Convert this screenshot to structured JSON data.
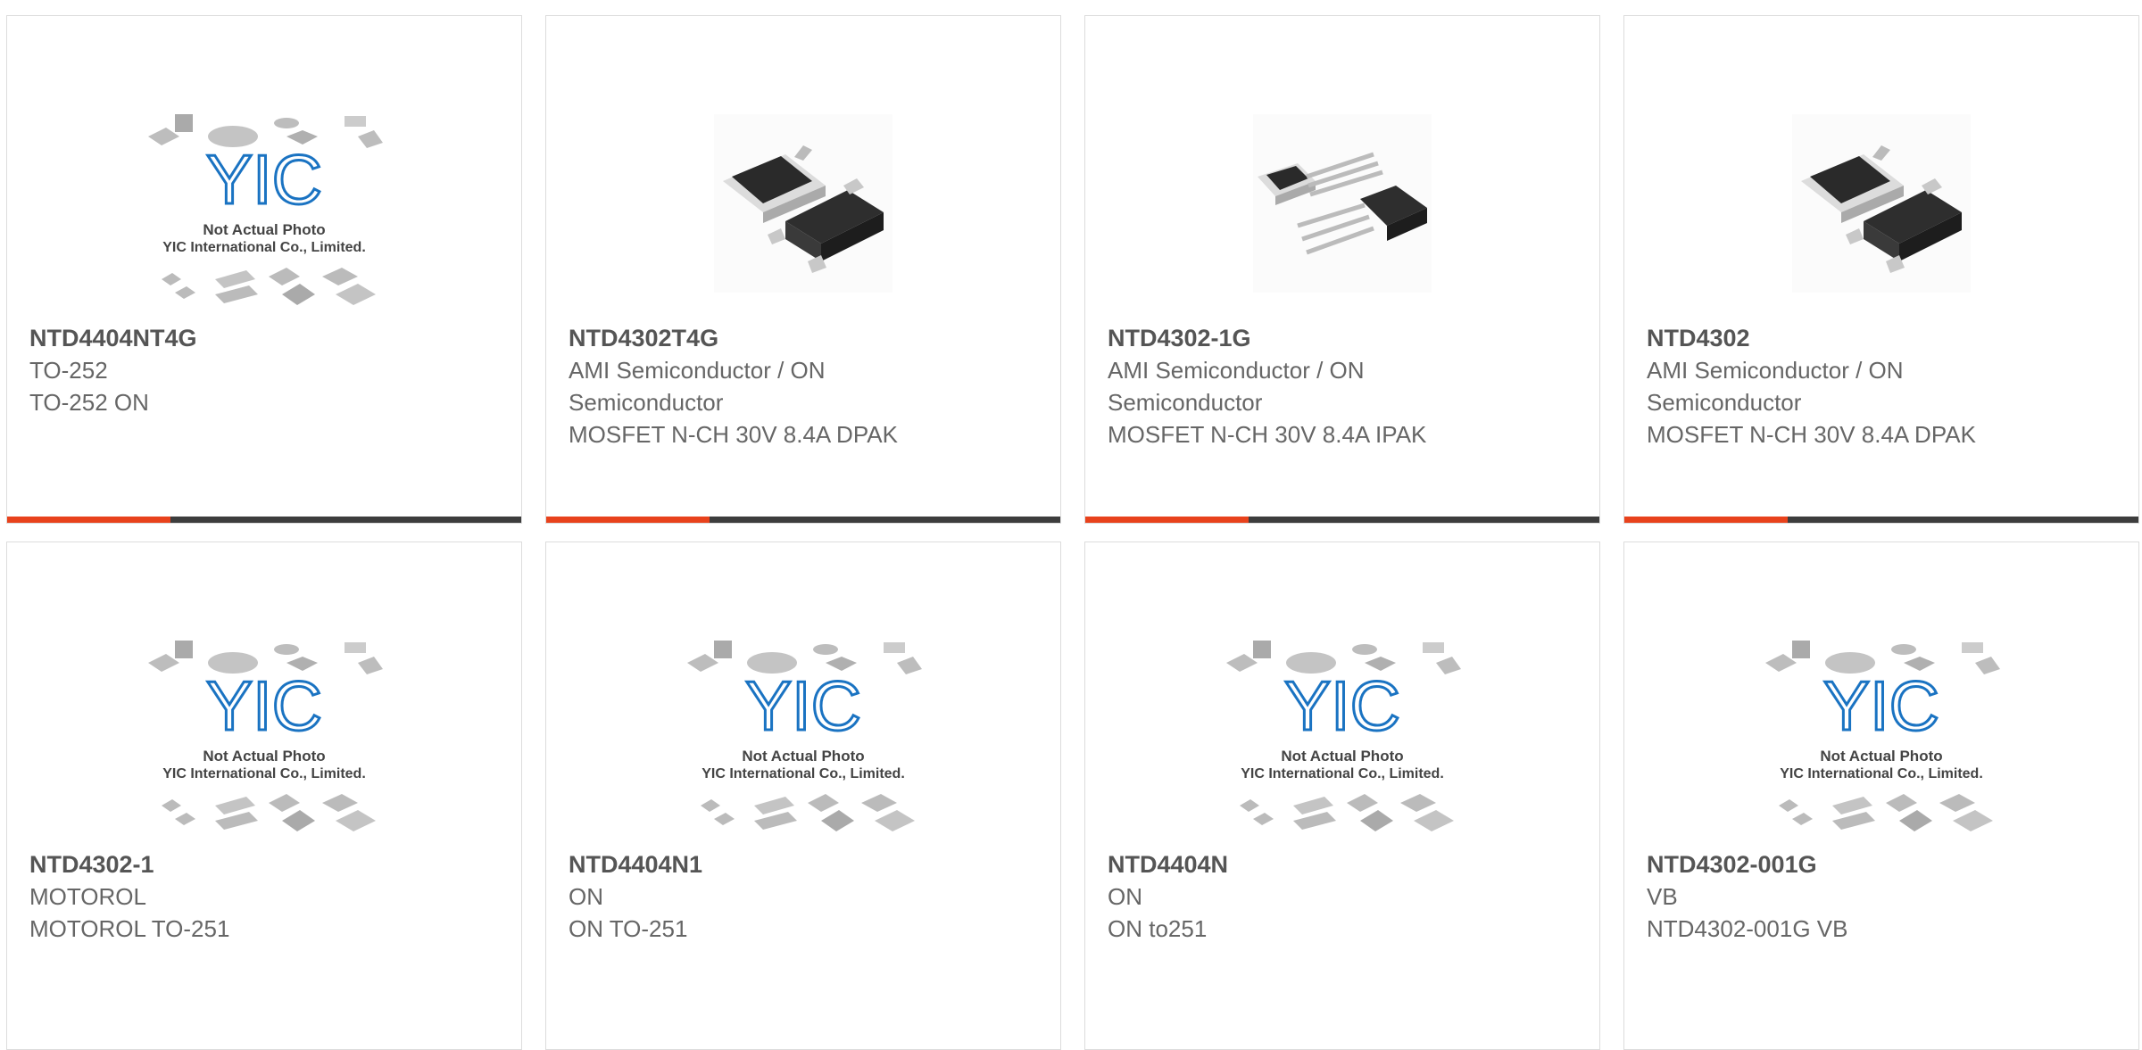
{
  "products": [
    {
      "part": "NTD4404NT4G",
      "lines": [
        "TO-252",
        "TO-252 ON"
      ],
      "image": "placeholder"
    },
    {
      "part": "NTD4302T4G",
      "lines": [
        "AMI Semiconductor / ON",
        "Semiconductor",
        "MOSFET N-CH 30V 8.4A DPAK"
      ],
      "image": "dpak"
    },
    {
      "part": "NTD4302-1G",
      "lines": [
        "AMI Semiconductor / ON",
        "Semiconductor",
        "MOSFET N-CH 30V 8.4A IPAK"
      ],
      "image": "ipak"
    },
    {
      "part": "NTD4302",
      "lines": [
        "AMI Semiconductor / ON",
        "Semiconductor",
        "MOSFET N-CH 30V 8.4A DPAK"
      ],
      "image": "dpak"
    },
    {
      "part": "NTD4302-1",
      "lines": [
        "MOTOROL",
        "MOTOROL TO-251"
      ],
      "image": "placeholder"
    },
    {
      "part": "NTD4404N1",
      "lines": [
        "ON",
        "ON TO-251"
      ],
      "image": "placeholder"
    },
    {
      "part": "NTD4404N",
      "lines": [
        "ON",
        "ON to251"
      ],
      "image": "placeholder"
    },
    {
      "part": "NTD4302-001G",
      "lines": [
        "VB",
        "NTD4302-001G VB"
      ],
      "image": "placeholder"
    }
  ],
  "placeholder": {
    "logo": "YIC",
    "caption1": "Not Actual Photo",
    "caption2": "YIC International Co., Limited."
  },
  "colors": {
    "accent": "#e8421c",
    "bar": "#3d3d3d",
    "logo": "#1a73c2"
  }
}
